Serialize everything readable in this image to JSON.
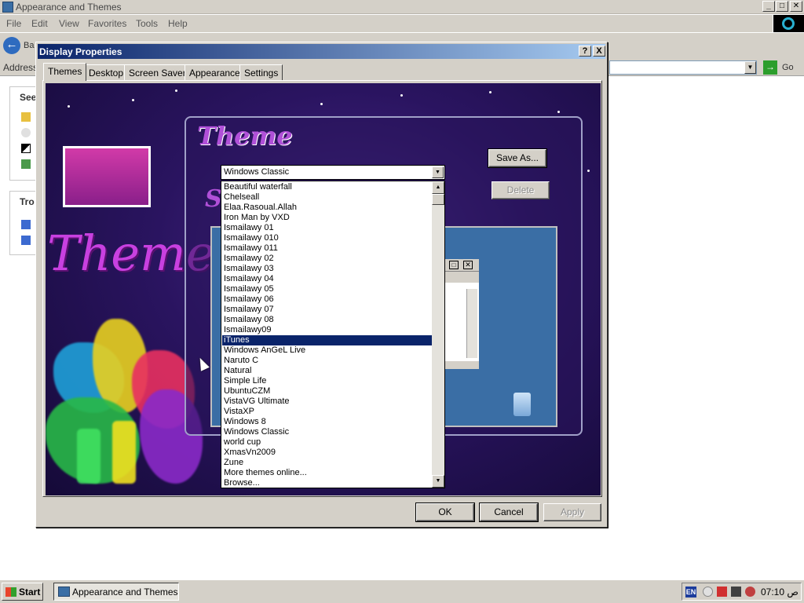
{
  "explorer": {
    "title": "Appearance and Themes",
    "menu": [
      "File",
      "Edit",
      "View",
      "Favorites",
      "Tools",
      "Help"
    ],
    "back_label": "Ba",
    "address_label": "Address",
    "go_label": "Go",
    "see_also_header": "See",
    "troubleshoot_header": "Tro"
  },
  "dialog": {
    "title": "Display Properties",
    "help_button": "?",
    "close_button": "X",
    "tabs": [
      "Themes",
      "Desktop",
      "Screen Saver",
      "Appearance",
      "Settings"
    ],
    "active_tab": "Themes",
    "preview": {
      "big_word": "Themes",
      "theme_heading": "Theme",
      "sample_heading": "S"
    },
    "theme_combo_value": "Windows Classic",
    "save_as_button": "Save As...",
    "delete_button": "Delete",
    "dropdown_items": [
      "Beautiful waterfall",
      "Chelseall",
      "Elaa.Rasoual.Allah",
      "Iron Man by VXD",
      "Ismailawy 01",
      "Ismailawy 010",
      "Ismailawy 011",
      "Ismailawy 02",
      "Ismailawy 03",
      "Ismailawy 04",
      "Ismailawy 05",
      "Ismailawy 06",
      "Ismailawy 07",
      "Ismailawy 08",
      "Ismailawy09",
      "iTunes",
      "Windows AnGeL Live",
      "Naruto C",
      "Natural",
      "Simple Life",
      "UbuntuCZM",
      "VistaVG Ultimate",
      "VistaXP",
      "Windows 8",
      "Windows Classic",
      "world cup",
      "XmasVn2009",
      "Zune",
      "More themes online...",
      "Browse..."
    ],
    "selected_item": "iTunes",
    "ok_button": "OK",
    "cancel_button": "Cancel",
    "apply_button": "Apply"
  },
  "taskbar": {
    "start_label": "Start",
    "task_label": "Appearance and Themes",
    "lang": "EN",
    "clock": "07:10 ص"
  },
  "colors": {
    "title_active": "#0a246a",
    "selection": "#0a246a",
    "face": "#d4d0c8",
    "preview_desktop": "#3a6ea5",
    "heading_purple": "#b050d8"
  }
}
